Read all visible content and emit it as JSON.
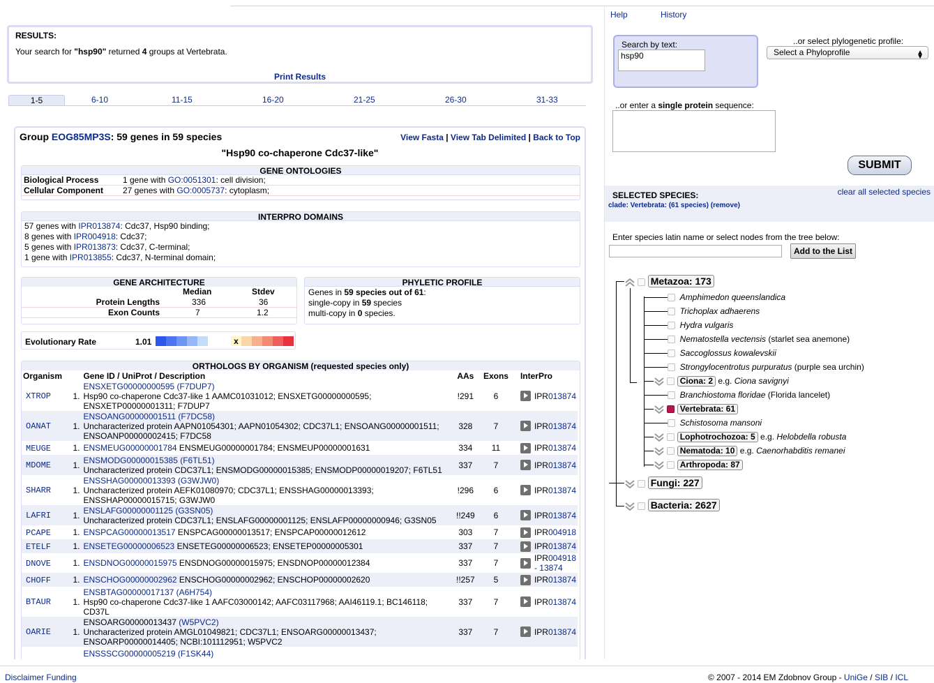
{
  "top_links": {
    "help": "Help",
    "history": "History"
  },
  "results": {
    "heading": "RESULTS:",
    "prefix": "Your search for ",
    "query": "\"hsp90\"",
    "mid": " returned ",
    "count": "4",
    "suffix": " groups at Vertebrata.",
    "print": "Print Results"
  },
  "page_tabs": [
    "1-5",
    "6-10",
    "11-15",
    "16-20",
    "21-25",
    "26-30",
    "31-33"
  ],
  "group": {
    "prefix": "Group ",
    "id": "EOG85MP3S",
    "summary": ": 59 genes in 59 species",
    "links": {
      "fasta": "View Fasta",
      "sep": " | ",
      "tab": "View Tab Delimited",
      "top": "Back to Top"
    },
    "name": "\"Hsp90 co-chaperone Cdc37-like\""
  },
  "ontologies": {
    "header": "GENE ONTOLOGIES",
    "rows": [
      {
        "label": "Biological Process",
        "pre": "1 gene with ",
        "go": "GO:0051301",
        "post": ": cell division;"
      },
      {
        "label": "Cellular Component",
        "pre": "27 genes with ",
        "go": "GO:0005737",
        "post": ": cytoplasm;"
      }
    ]
  },
  "interpro": {
    "header": "INTERPRO DOMAINS",
    "rows": [
      {
        "pre": "57 genes with ",
        "id": "IPR013874",
        "post": ": Cdc37, Hsp90 binding;"
      },
      {
        "pre": "8 genes with ",
        "id": "IPR004918",
        "post": ": Cdc37;"
      },
      {
        "pre": "5 genes with ",
        "id": "IPR013873",
        "post": ": Cdc37, C-terminal;"
      },
      {
        "pre": "1 gene with ",
        "id": "IPR013855",
        "post": ": Cdc37, N-terminal domain;"
      }
    ]
  },
  "architecture": {
    "header": "GENE ARCHITECTURE",
    "col_median": "Median",
    "col_stdev": "Stdev",
    "rows": [
      {
        "label": "Protein Lengths",
        "median": "336",
        "stdev": "36"
      },
      {
        "label": "Exon Counts",
        "median": "7",
        "stdev": "1.2"
      }
    ]
  },
  "phyletic": {
    "header": "PHYLETIC PROFILE",
    "l1_pre": "Genes in ",
    "l1_b": "59 species out of 61",
    "l1_post": ":",
    "l2_pre": "single-copy in ",
    "l2_b": "59",
    "l2_post": " species",
    "l3_pre": "multi-copy in ",
    "l3_b": "0",
    "l3_post": " species."
  },
  "evo": {
    "label": "Evolutionary Rate",
    "value": "1.01",
    "marker": "x",
    "blue_colors": [
      "#2b57ea",
      "#4a74f0",
      "#6d93f4",
      "#97b6f7",
      "#c3dcfa"
    ],
    "red_colors": [
      "#fbd6a8",
      "#f8b08a",
      "#f48a72",
      "#ee5e5e",
      "#e8323e"
    ]
  },
  "orthologs": {
    "header": "ORTHOLOGS BY ORGANISM (requested species only)",
    "columns": {
      "organism": "Organism",
      "gene": "Gene ID / UniProt / Description",
      "aas": "AAs",
      "exons": "Exons",
      "interpro": "InterPro"
    },
    "rows": [
      {
        "org": "XTROP",
        "num": "1.",
        "lines": [
          [
            {
              "t": "ENSXETG00000000595 (F7DUP7)",
              "l": true
            }
          ],
          [
            {
              "t": "Hsp90 co-chaperone Cdc37-like 1 AAMC01031012; ENSXETG00000000595;"
            }
          ],
          [
            {
              "t": "ENSXETP00000001311; F7DUP7"
            }
          ]
        ],
        "aas": "!291",
        "exons": "6",
        "ipr": "IPR",
        "ipr_link": "013874"
      },
      {
        "org": "OANAT",
        "num": "1.",
        "lines": [
          [
            {
              "t": "ENSOANG00000001511 (F7DC58)",
              "l": true
            }
          ],
          [
            {
              "t": "Uncharacterized protein AAPN01054301; AAPN01054302; CDC37L1; ENSOANG00000001511;"
            }
          ],
          [
            {
              "t": "ENSOANP00000002415; F7DC58"
            }
          ]
        ],
        "aas": "328",
        "exons": "7",
        "ipr": "IPR",
        "ipr_link": "013874"
      },
      {
        "org": "MEUGE",
        "num": "1.",
        "lines": [
          [
            {
              "t": "ENSMEUG00000001784",
              "l": true
            },
            {
              "t": " ENSMEUG00000001784; ENSMEUP00000001631"
            }
          ]
        ],
        "aas": "334",
        "exons": "11",
        "ipr": "IPR",
        "ipr_link": "013874"
      },
      {
        "org": "MDOME",
        "num": "1.",
        "lines": [
          [
            {
              "t": "ENSMODG00000015385 (F6TL51)",
              "l": true
            }
          ],
          [
            {
              "t": "Uncharacterized protein CDC37L1; ENSMODG00000015385; ENSMODP00000019207; F6TL51"
            }
          ]
        ],
        "aas": "337",
        "exons": "7",
        "ipr": "IPR",
        "ipr_link": "013874"
      },
      {
        "org": "SHARR",
        "num": "1.",
        "lines": [
          [
            {
              "t": "ENSSHAG00000013393 (G3WJW0)",
              "l": true
            }
          ],
          [
            {
              "t": "Uncharacterized protein AEFK01080970; CDC37L1; ENSSHAG00000013393;"
            }
          ],
          [
            {
              "t": "ENSSHAP00000015715; G3WJW0"
            }
          ]
        ],
        "aas": "!296",
        "exons": "6",
        "ipr": "IPR",
        "ipr_link": "013874"
      },
      {
        "org": "LAFRI",
        "num": "1.",
        "lines": [
          [
            {
              "t": "ENSLAFG00000001125 (G3SN05)",
              "l": true
            }
          ],
          [
            {
              "t": "Uncharacterized protein CDC37L1; ENSLAFG00000001125; ENSLAFP00000000946; G3SN05"
            }
          ]
        ],
        "aas": "!!249",
        "exons": "6",
        "ipr": "IPR",
        "ipr_link": "013874"
      },
      {
        "org": "PCAPE",
        "num": "1.",
        "lines": [
          [
            {
              "t": "ENSPCAG00000013517",
              "l": true
            },
            {
              "t": " ENSPCAG00000013517; ENSPCAP00000012612"
            }
          ]
        ],
        "aas": "303",
        "exons": "7",
        "ipr": "IPR",
        "ipr_link": "004918"
      },
      {
        "org": "ETELF",
        "num": "1.",
        "lines": [
          [
            {
              "t": "ENSETEG00000006523",
              "l": true
            },
            {
              "t": " ENSETEG00000006523; ENSETEP00000005301"
            }
          ]
        ],
        "aas": "337",
        "exons": "7",
        "ipr": "IPR",
        "ipr_link": "013874"
      },
      {
        "org": "DNOVE",
        "num": "1.",
        "lines": [
          [
            {
              "t": "ENSDNOG00000015975",
              "l": true
            },
            {
              "t": " ENSDNOG00000015975; ENSDNOP00000012384"
            }
          ]
        ],
        "aas": "337",
        "exons": "7",
        "ipr": "IPR",
        "ipr_link": "004918",
        "ipr_extra": "- 13874"
      },
      {
        "org": "CHOFF",
        "num": "1.",
        "lines": [
          [
            {
              "t": "ENSCHOG00000002962",
              "l": true
            },
            {
              "t": " ENSCHOG00000002962; ENSCHOP00000002620"
            }
          ]
        ],
        "aas": "!!257",
        "exons": "5",
        "ipr": "IPR",
        "ipr_link": "013874"
      },
      {
        "org": "BTAUR",
        "num": "1.",
        "lines": [
          [
            {
              "t": "ENSBTAG00000017137 (A6H754)",
              "l": true
            }
          ],
          [
            {
              "t": "Hsp90 co-chaperone Cdc37-like 1 AAFC03000142; AAFC03117968; AAI46119.1; BC146118;"
            }
          ],
          [
            {
              "t": "CD37L"
            }
          ]
        ],
        "aas": "337",
        "exons": "7",
        "ipr": "IPR",
        "ipr_link": "013874"
      },
      {
        "org": "OARIE",
        "num": "1.",
        "lines": [
          [
            {
              "t": "ENSOARG00000013437"
            },
            {
              "t": "  (W5PVC2)",
              "l": true
            }
          ],
          [
            {
              "t": "Uncharacterized protein AMGL01049821; CDC37L1; ENSOARG00000013437;"
            }
          ],
          [
            {
              "t": "ENSOARP00000014405; NCBI:101112951; W5PVC2"
            }
          ]
        ],
        "aas": "337",
        "exons": "7",
        "ipr": "IPR",
        "ipr_link": "013874"
      },
      {
        "org": "",
        "num": "",
        "lines": [
          [
            {
              "t": "ENSSSCG00000005219 (F1SK44)",
              "l": true
            }
          ]
        ],
        "aas": "",
        "exons": "",
        "ipr": "",
        "ipr_link": ""
      }
    ]
  },
  "search": {
    "label": "Search by text:",
    "value": "hsp90",
    "phylo_label": "..or select plylogenetic profile:",
    "phylo_selected": "Select a Phyloprofile",
    "seq_pre": "..or enter a ",
    "seq_b": "single protein",
    "seq_post": " sequence:",
    "submit": "SUBMIT"
  },
  "species": {
    "heading": "SELECTED SPECIES:",
    "clear": "clear all selected species",
    "clade": "clade: Vertebrata: (61 species) (remove)",
    "enter_label": "Enter species latin name or select nodes from the tree below:",
    "add": "Add to the List"
  },
  "tree": {
    "metazoa": "Metazoa: 173",
    "amph": "Amphimedon queenslandica",
    "trich": "Trichoplax adhaerens",
    "hydra": "Hydra vulgaris",
    "nemv_i": "Nematostella vectensis",
    "nemv_c": " (starlet sea anemone)",
    "sacco": "Saccoglossus kowalevskii",
    "strong_i": "Strongylocentrotus purpuratus",
    "strong_c": " (purple sea urchin)",
    "ciona": "Ciona: 2",
    "ciona_eg": " e.g. ",
    "ciona_sp": "Ciona savignyi",
    "branch_i": "Branchiostoma floridae",
    "branch_c": " (Florida lancelet)",
    "vert": "Vertebrata: 61",
    "schisto": "Schistosoma mansoni",
    "lopho": "Lophotrochozoa: 5",
    "lopho_eg": " e.g. ",
    "lopho_sp": "Helobdella robusta",
    "nema": "Nematoda: 10",
    "nema_eg": " e.g. ",
    "nema_sp": "Caenorhabditis remanei",
    "arthro": "Arthropoda: 87",
    "fungi": "Fungi: 227",
    "bacteria": "Bacteria: 2627"
  },
  "footer": {
    "disclaimer": "Disclaimer",
    "funding": "Funding",
    "copyright": "© 2007 - 2014 EM Zdobnov Group - ",
    "unige": "UniGe",
    "sib": "SIB",
    "icl": "ICL",
    "slash": " / "
  }
}
